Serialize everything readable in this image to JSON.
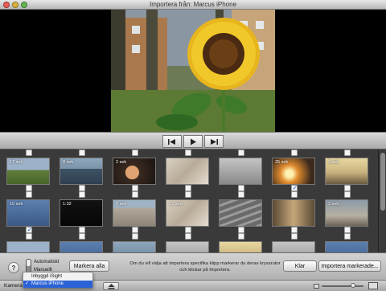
{
  "window": {
    "title": "Importera från: Marcus iPhone"
  },
  "grid": {
    "rows": [
      {
        "top_checked": [
          false,
          false,
          false,
          false,
          false,
          false,
          false
        ],
        "bottom_checked": [
          false,
          false,
          false,
          false,
          false,
          true,
          false
        ],
        "clips": [
          {
            "duration": "17 sek",
            "scene": "field"
          },
          {
            "duration": "8 sek",
            "scene": "water"
          },
          {
            "duration": "2 sek",
            "scene": "portrait"
          },
          {
            "duration": "",
            "scene": "paper"
          },
          {
            "duration": "",
            "scene": "grey"
          },
          {
            "duration": "25 sek",
            "scene": "sunset"
          },
          {
            "duration": "2 sek",
            "scene": "sky"
          }
        ]
      },
      {
        "top_checked": [
          false,
          false,
          false,
          false,
          false,
          false,
          false
        ],
        "bottom_checked": [
          true,
          false,
          false,
          false,
          false,
          false,
          false
        ],
        "clips": [
          {
            "duration": "10 sek",
            "scene": "blue"
          },
          {
            "duration": "1:32",
            "scene": "black"
          },
          {
            "duration": "9 sek",
            "scene": "building"
          },
          {
            "duration": "12 sek",
            "scene": "paper"
          },
          {
            "duration": "",
            "scene": "stairs"
          },
          {
            "duration": "",
            "scene": "corridor"
          },
          {
            "duration": "3 sek",
            "scene": "room"
          }
        ]
      },
      {
        "top_checked": [
          false,
          false,
          false,
          false,
          false,
          false,
          false
        ],
        "bottom_checked": [
          false,
          false,
          false,
          false,
          false,
          false,
          false
        ],
        "clips": [
          {
            "duration": "",
            "scene": "field"
          },
          {
            "duration": "",
            "scene": "blue"
          },
          {
            "duration": "",
            "scene": "water"
          },
          {
            "duration": "",
            "scene": "grey"
          },
          {
            "duration": "",
            "scene": "sky"
          },
          {
            "duration": "",
            "scene": "grey"
          },
          {
            "duration": "",
            "scene": "blue"
          }
        ]
      }
    ]
  },
  "controls": {
    "help_label": "?",
    "mode_automatic": "Automatiskt",
    "mode_manual": "Manuellt",
    "select_all_label": "Markera alla",
    "info_text": "Om du vill välja att importera specifika klipp markerar du deras kryssrutor och klickar på Importera.",
    "done_label": "Klar",
    "import_selected_label": "Importera markerade..."
  },
  "status_bar": {
    "camera_label": "Kamera:",
    "camera_options": [
      "Inbyggd iSight",
      "Marcus iPhone"
    ],
    "camera_selected": "Marcus iPhone",
    "check_glyph": "✓",
    "thumbnail_size_level": 0.75
  },
  "colors": {
    "selection": "#2b62d6",
    "checkmark": "#1c62c8"
  }
}
